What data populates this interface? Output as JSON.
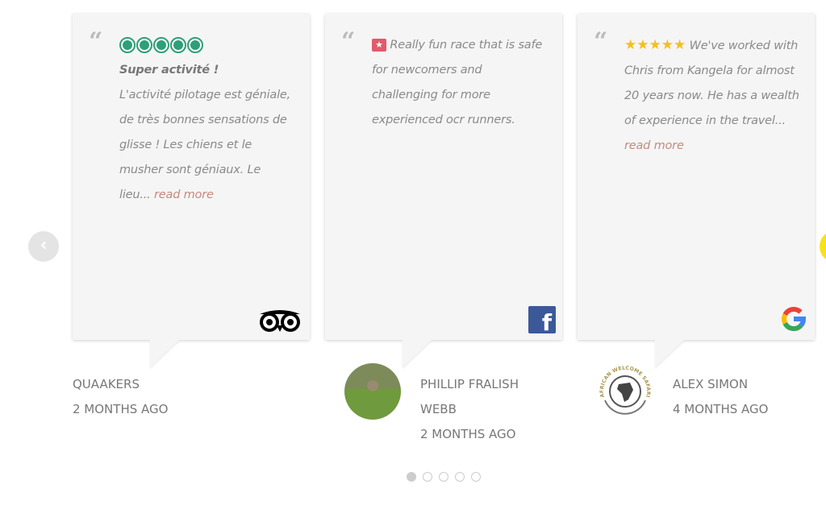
{
  "reviews": [
    {
      "title": "Super activité !",
      "text": "L'activité pilotage est géniale, de très bonnes sensations de glisse ! Les chiens et le musher sont géniaux. Le lieu...",
      "read_more": "read more",
      "rating": 5,
      "source": "tripadvisor-icon",
      "reviewer": "Quaakers",
      "time": "2 months ago"
    },
    {
      "text": "Really fun race that is safe for newcomers and challenging for more experienced ocr runners.",
      "source": "facebook-icon",
      "reviewer": "Phillip Fralish Webb",
      "time": "2 months ago"
    },
    {
      "text": "We've worked with Chris from Kangela for almost 20 years now. He has a wealth of experience in the travel...",
      "read_more": "read more",
      "rating": 5,
      "source": "google-icon",
      "reviewer": "Alex Simon",
      "time": "4 months ago",
      "avatar_logo_text": "AFRICAN WELCOME SAFARIS"
    }
  ],
  "nav": {
    "prev": "‹",
    "active_page": 1,
    "pages": 5
  },
  "colors": {
    "tripadvisor": "#2e9f78",
    "star": "#f4c01e",
    "facebook": "#3b5998",
    "read_more": "#c58a7e"
  }
}
